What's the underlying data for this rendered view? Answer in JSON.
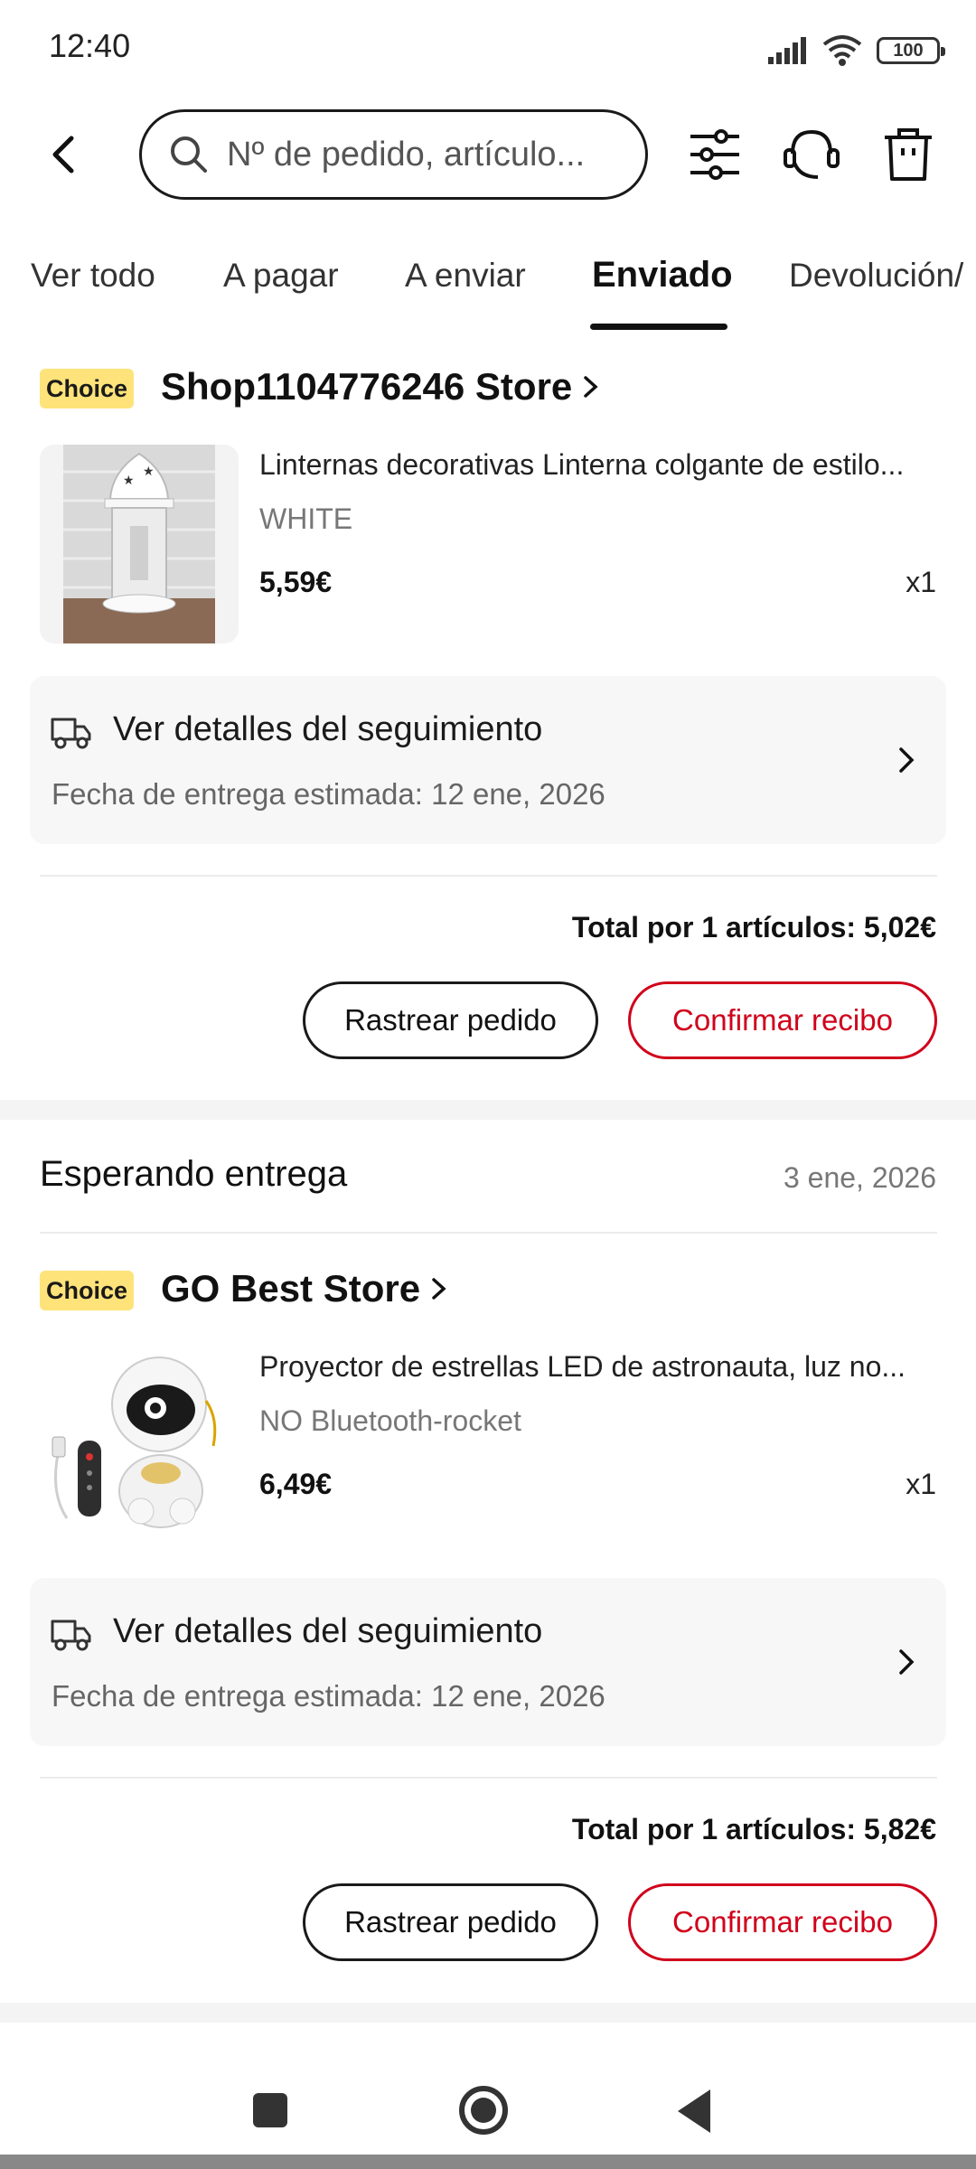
{
  "status_bar": {
    "time": "12:40",
    "battery": "100"
  },
  "header": {
    "search_placeholder": "Nº de pedido, artículo..."
  },
  "tabs": [
    "Ver todo",
    "A pagar",
    "A enviar",
    "Enviado",
    "Devolución/"
  ],
  "active_tab": "Enviado",
  "orders": [
    {
      "badge": "Choice",
      "store": "Shop1104776246 Store",
      "product_title": "Linternas decorativas Linterna colgante de estilo...",
      "variant": "WHITE",
      "price": "5,59€",
      "qty": "x1",
      "tracking_title": "Ver detalles del seguimiento",
      "tracking_date": "Fecha de entrega estimada: 12 ene, 2026",
      "total": "Total por 1 artículos: 5,02€",
      "track_btn": "Rastrear pedido",
      "confirm_btn": "Confirmar recibo"
    },
    {
      "status": "Esperando entrega",
      "date": "3 ene, 2026",
      "badge": "Choice",
      "store": "GO Best Store",
      "product_title": "Proyector de estrellas LED de astronauta, luz no...",
      "variant": "NO Bluetooth-rocket",
      "price": "6,49€",
      "qty": "x1",
      "tracking_title": "Ver detalles del seguimiento",
      "tracking_date": "Fecha de entrega estimada: 12 ene, 2026",
      "total": "Total por 1 artículos: 5,82€",
      "track_btn": "Rastrear pedido",
      "confirm_btn": "Confirmar recibo"
    }
  ],
  "colors": {
    "accent": "#d0021b",
    "choice_badge": "#fde37a"
  },
  "icons": [
    "back-arrow-icon",
    "search-icon",
    "filter-sliders-icon",
    "headset-support-icon",
    "trash-icon",
    "truck-icon",
    "chevron-right-icon"
  ]
}
